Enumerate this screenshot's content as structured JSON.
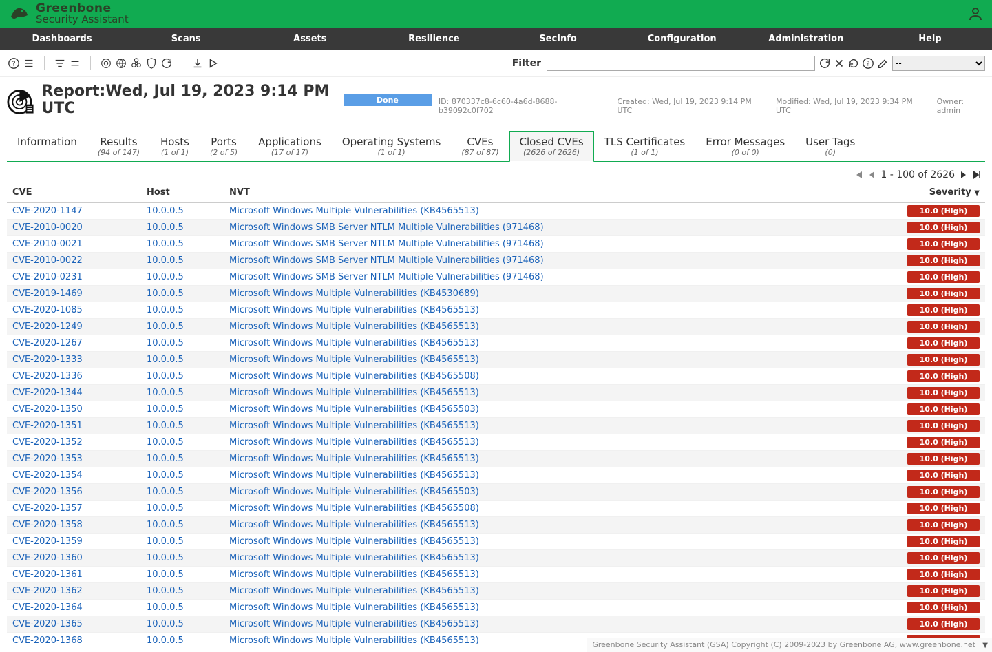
{
  "brand": {
    "line1": "Greenbone",
    "line2": "Security Assistant"
  },
  "nav": [
    "Dashboards",
    "Scans",
    "Assets",
    "Resilience",
    "SecInfo",
    "Configuration",
    "Administration",
    "Help"
  ],
  "filter": {
    "label": "Filter",
    "value": "",
    "select_initial": "--"
  },
  "report": {
    "title_prefix": "Report:",
    "title_date": "Wed, Jul 19, 2023 9:14 PM UTC",
    "status": "Done",
    "id_label": "ID:",
    "id": "870337c8-6c60-4a6d-8688-b39092c0f702",
    "created_label": "Created:",
    "created": "Wed, Jul 19, 2023 9:14 PM UTC",
    "modified_label": "Modified:",
    "modified": "Wed, Jul 19, 2023 9:34 PM UTC",
    "owner_label": "Owner:",
    "owner": "admin"
  },
  "tabs": [
    {
      "label": "Information",
      "count": ""
    },
    {
      "label": "Results",
      "count": "(94 of 147)"
    },
    {
      "label": "Hosts",
      "count": "(1 of 1)"
    },
    {
      "label": "Ports",
      "count": "(2 of 5)"
    },
    {
      "label": "Applications",
      "count": "(17 of 17)"
    },
    {
      "label": "Operating Systems",
      "count": "(1 of 1)"
    },
    {
      "label": "CVEs",
      "count": "(87 of 87)"
    },
    {
      "label": "Closed CVEs",
      "count": "(2626 of 2626)",
      "active": true
    },
    {
      "label": "TLS Certificates",
      "count": "(1 of 1)"
    },
    {
      "label": "Error Messages",
      "count": "(0 of 0)"
    },
    {
      "label": "User Tags",
      "count": "(0)"
    }
  ],
  "pagination": {
    "text": "1 - 100 of 2626"
  },
  "columns": {
    "cve": "CVE",
    "host": "Host",
    "nvt": "NVT",
    "severity": "Severity"
  },
  "rows": [
    {
      "cve": "CVE-2020-1147",
      "host": "10.0.0.5",
      "nvt": "Microsoft Windows Multiple Vulnerabilities (KB4565513)",
      "sev": "10.0 (High)"
    },
    {
      "cve": "CVE-2010-0020",
      "host": "10.0.0.5",
      "nvt": "Microsoft Windows SMB Server NTLM Multiple Vulnerabilities (971468)",
      "sev": "10.0 (High)"
    },
    {
      "cve": "CVE-2010-0021",
      "host": "10.0.0.5",
      "nvt": "Microsoft Windows SMB Server NTLM Multiple Vulnerabilities (971468)",
      "sev": "10.0 (High)"
    },
    {
      "cve": "CVE-2010-0022",
      "host": "10.0.0.5",
      "nvt": "Microsoft Windows SMB Server NTLM Multiple Vulnerabilities (971468)",
      "sev": "10.0 (High)"
    },
    {
      "cve": "CVE-2010-0231",
      "host": "10.0.0.5",
      "nvt": "Microsoft Windows SMB Server NTLM Multiple Vulnerabilities (971468)",
      "sev": "10.0 (High)"
    },
    {
      "cve": "CVE-2019-1469",
      "host": "10.0.0.5",
      "nvt": "Microsoft Windows Multiple Vulnerabilities (KB4530689)",
      "sev": "10.0 (High)"
    },
    {
      "cve": "CVE-2020-1085",
      "host": "10.0.0.5",
      "nvt": "Microsoft Windows Multiple Vulnerabilities (KB4565513)",
      "sev": "10.0 (High)"
    },
    {
      "cve": "CVE-2020-1249",
      "host": "10.0.0.5",
      "nvt": "Microsoft Windows Multiple Vulnerabilities (KB4565513)",
      "sev": "10.0 (High)"
    },
    {
      "cve": "CVE-2020-1267",
      "host": "10.0.0.5",
      "nvt": "Microsoft Windows Multiple Vulnerabilities (KB4565513)",
      "sev": "10.0 (High)"
    },
    {
      "cve": "CVE-2020-1333",
      "host": "10.0.0.5",
      "nvt": "Microsoft Windows Multiple Vulnerabilities (KB4565513)",
      "sev": "10.0 (High)"
    },
    {
      "cve": "CVE-2020-1336",
      "host": "10.0.0.5",
      "nvt": "Microsoft Windows Multiple Vulnerabilities (KB4565508)",
      "sev": "10.0 (High)"
    },
    {
      "cve": "CVE-2020-1344",
      "host": "10.0.0.5",
      "nvt": "Microsoft Windows Multiple Vulnerabilities (KB4565513)",
      "sev": "10.0 (High)"
    },
    {
      "cve": "CVE-2020-1350",
      "host": "10.0.0.5",
      "nvt": "Microsoft Windows Multiple Vulnerabilities (KB4565503)",
      "sev": "10.0 (High)"
    },
    {
      "cve": "CVE-2020-1351",
      "host": "10.0.0.5",
      "nvt": "Microsoft Windows Multiple Vulnerabilities (KB4565513)",
      "sev": "10.0 (High)"
    },
    {
      "cve": "CVE-2020-1352",
      "host": "10.0.0.5",
      "nvt": "Microsoft Windows Multiple Vulnerabilities (KB4565513)",
      "sev": "10.0 (High)"
    },
    {
      "cve": "CVE-2020-1353",
      "host": "10.0.0.5",
      "nvt": "Microsoft Windows Multiple Vulnerabilities (KB4565513)",
      "sev": "10.0 (High)"
    },
    {
      "cve": "CVE-2020-1354",
      "host": "10.0.0.5",
      "nvt": "Microsoft Windows Multiple Vulnerabilities (KB4565513)",
      "sev": "10.0 (High)"
    },
    {
      "cve": "CVE-2020-1356",
      "host": "10.0.0.5",
      "nvt": "Microsoft Windows Multiple Vulnerabilities (KB4565503)",
      "sev": "10.0 (High)"
    },
    {
      "cve": "CVE-2020-1357",
      "host": "10.0.0.5",
      "nvt": "Microsoft Windows Multiple Vulnerabilities (KB4565508)",
      "sev": "10.0 (High)"
    },
    {
      "cve": "CVE-2020-1358",
      "host": "10.0.0.5",
      "nvt": "Microsoft Windows Multiple Vulnerabilities (KB4565513)",
      "sev": "10.0 (High)"
    },
    {
      "cve": "CVE-2020-1359",
      "host": "10.0.0.5",
      "nvt": "Microsoft Windows Multiple Vulnerabilities (KB4565513)",
      "sev": "10.0 (High)"
    },
    {
      "cve": "CVE-2020-1360",
      "host": "10.0.0.5",
      "nvt": "Microsoft Windows Multiple Vulnerabilities (KB4565513)",
      "sev": "10.0 (High)"
    },
    {
      "cve": "CVE-2020-1361",
      "host": "10.0.0.5",
      "nvt": "Microsoft Windows Multiple Vulnerabilities (KB4565513)",
      "sev": "10.0 (High)"
    },
    {
      "cve": "CVE-2020-1362",
      "host": "10.0.0.5",
      "nvt": "Microsoft Windows Multiple Vulnerabilities (KB4565513)",
      "sev": "10.0 (High)"
    },
    {
      "cve": "CVE-2020-1364",
      "host": "10.0.0.5",
      "nvt": "Microsoft Windows Multiple Vulnerabilities (KB4565513)",
      "sev": "10.0 (High)"
    },
    {
      "cve": "CVE-2020-1365",
      "host": "10.0.0.5",
      "nvt": "Microsoft Windows Multiple Vulnerabilities (KB4565513)",
      "sev": "10.0 (High)"
    },
    {
      "cve": "CVE-2020-1368",
      "host": "10.0.0.5",
      "nvt": "Microsoft Windows Multiple Vulnerabilities (KB4565513)",
      "sev": "10.0 (High)"
    }
  ],
  "footer": "Greenbone Security Assistant (GSA) Copyright (C) 2009-2023 by Greenbone AG, www.greenbone.net"
}
